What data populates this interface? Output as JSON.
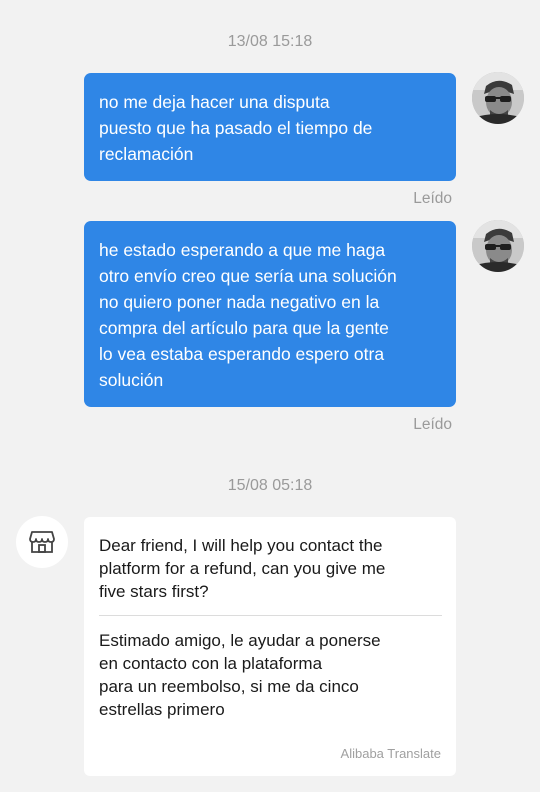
{
  "timestamps": {
    "first": "13/08 15:18",
    "second": "15/08 05:18"
  },
  "messages_out": [
    {
      "text": "no me deja hacer una disputa\npuesto que ha pasado el tiempo de\nreclamación",
      "status": "Leído"
    },
    {
      "text": "he estado esperando a que me haga\notro envío creo que sería una solución\nno quiero poner nada negativo en la\ncompra del artículo para que la gente\nlo vea estaba esperando espero otra\nsolución",
      "status": "Leído"
    }
  ],
  "message_in": {
    "original": "Dear friend, I will help you contact the\nplatform for a refund, can you give me\nfive stars first?",
    "translation": "Estimado amigo, le ayudar a ponerse\nen contacto con la plataforma\npara un reembolso, si me da cinco\nestrellas primero",
    "translated_by": "Alibaba Translate"
  },
  "colors": {
    "background": "#f2f2f2",
    "outgoing_bubble": "#2f86e6",
    "incoming_bubble": "#ffffff",
    "muted_text": "#9a9a9a"
  },
  "icons": {
    "user_avatar": "user-photo-avatar",
    "store_avatar": "store-icon"
  }
}
